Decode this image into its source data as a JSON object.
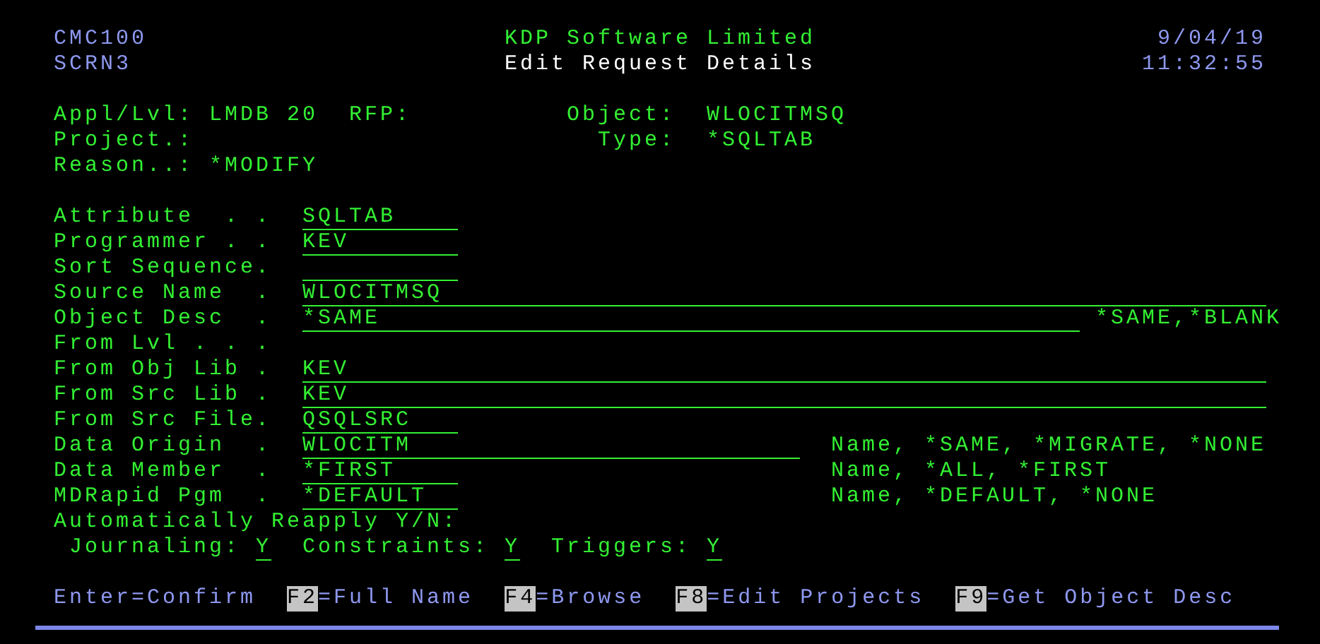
{
  "header": {
    "program": "CMC100",
    "screen": "SCRN3",
    "company": "KDP Software Limited",
    "title": "Edit Request Details",
    "date": "9/04/19",
    "time": "11:32:55"
  },
  "info": {
    "appl_lvl": {
      "label": "Appl/Lvl:",
      "value": "LMDB 20"
    },
    "rfp": {
      "label": "RFP:"
    },
    "object": {
      "label": "Object:",
      "value": "WLOCITMSQ"
    },
    "project": {
      "label": "Project.:"
    },
    "type": {
      "label": "Type:",
      "value": "*SQLTAB"
    },
    "reason": {
      "label": "Reason..:",
      "value": "*MODIFY"
    }
  },
  "fields": [
    {
      "label": "Attribute  . .",
      "value": "SQLTAB"
    },
    {
      "label": "Programmer . .",
      "value": "KEV"
    },
    {
      "label": "Sort Sequence."
    },
    {
      "label": "Source Name  .",
      "value": "WLOCITMSQ"
    },
    {
      "label": "Object Desc  .",
      "value": "*SAME",
      "hint": "*SAME,*BLANK"
    },
    {
      "label": "From Lvl . . ."
    },
    {
      "label": "From Obj Lib .",
      "value": "KEV"
    },
    {
      "label": "From Src Lib .",
      "value": "KEV"
    },
    {
      "label": "From Src File.",
      "value": "QSQLSRC"
    },
    {
      "label": "Data Origin  .",
      "value": "WLOCITM",
      "hint": "Name, *SAME, *MIGRATE, *NONE"
    },
    {
      "label": "Data Member  .",
      "value": "*FIRST",
      "hint": "Name, *ALL, *FIRST"
    },
    {
      "label": "MDRapid Pgm  .",
      "value": "*DEFAULT",
      "hint": "Name, *DEFAULT, *NONE"
    }
  ],
  "reapply": {
    "label": "Automatically Reapply Y/N:",
    "options": [
      {
        "label": "Journaling:",
        "value": "Y"
      },
      {
        "label": "Constraints:",
        "value": "Y"
      },
      {
        "label": "Triggers:",
        "value": "Y"
      }
    ]
  },
  "function_keys": [
    {
      "kind": "plain",
      "key": "Enter",
      "label": "=Confirm"
    },
    {
      "kind": "fkey",
      "key": "F2",
      "label": "=Full Name"
    },
    {
      "kind": "fkey",
      "key": "F4",
      "label": "=Browse"
    },
    {
      "kind": "fkey",
      "key": "F8",
      "label": "=Edit Projects"
    },
    {
      "kind": "fkey",
      "key": "F9",
      "label": "=Get Object Desc"
    }
  ]
}
